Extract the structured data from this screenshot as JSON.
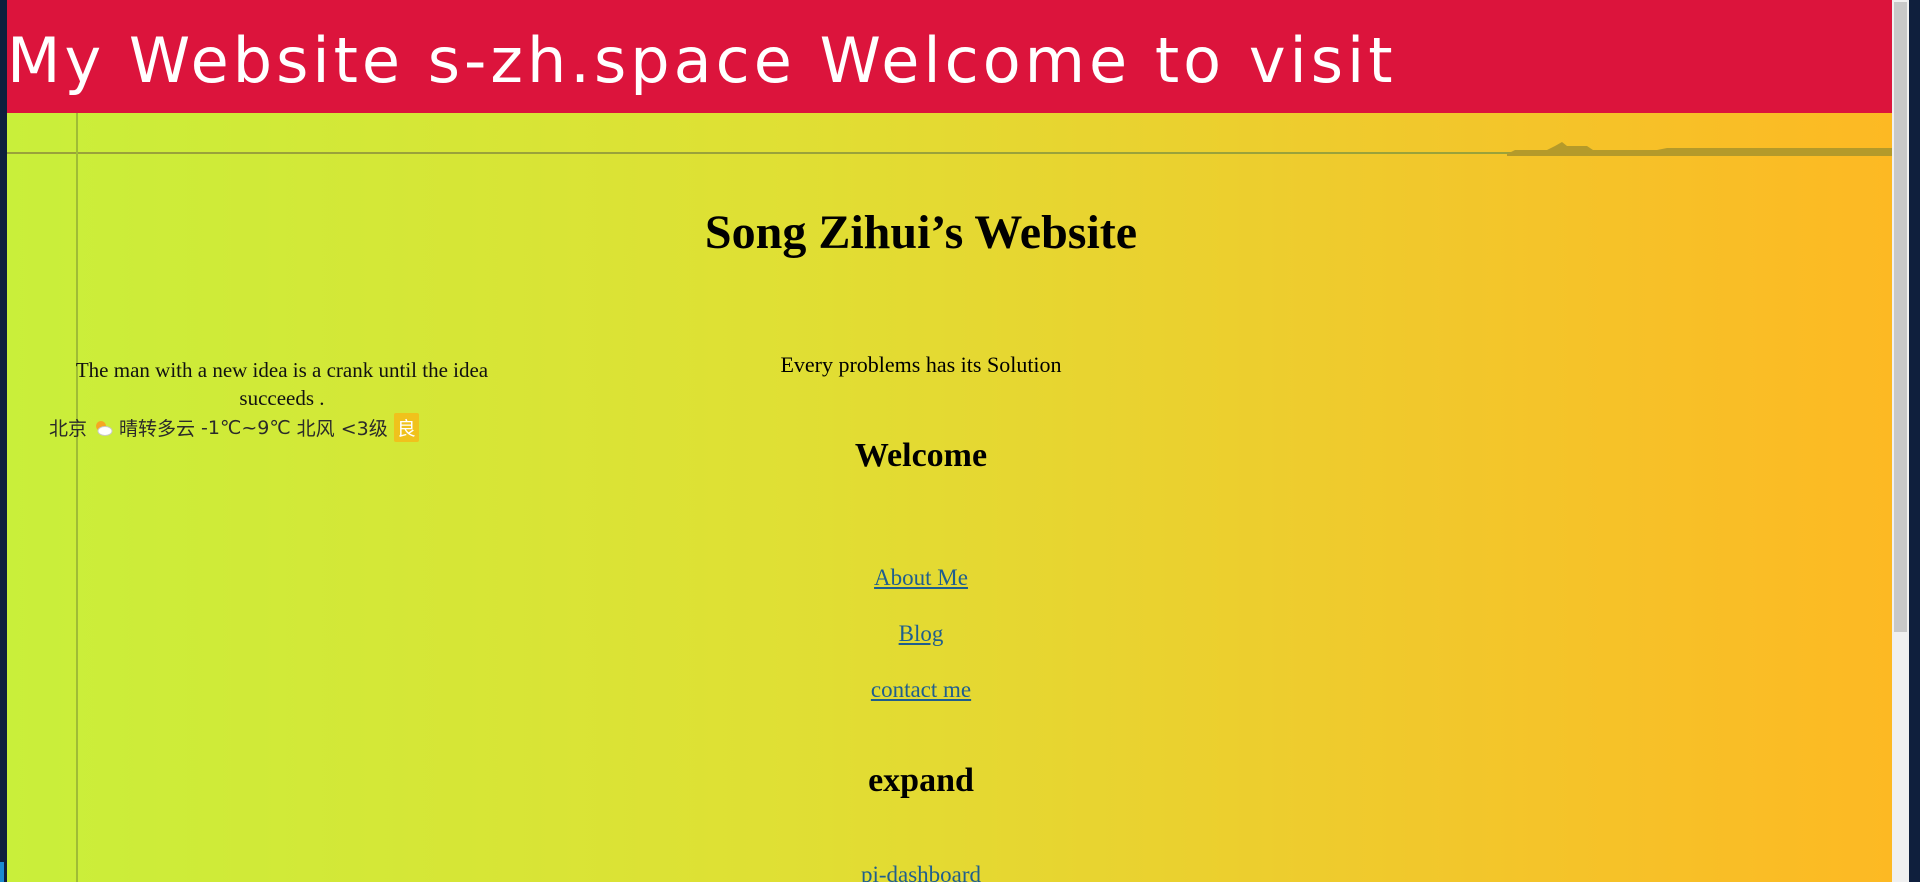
{
  "banner": {
    "text": "My Website s-zh.space Welcome to visit",
    "color": "#dc143c"
  },
  "page": {
    "title": "Song Zihui’s Website",
    "motto": "Every problems has its Solution",
    "welcome_heading": "Welcome",
    "expand_heading": "expand",
    "gradient_colors": [
      "#c9ef3a",
      "#fdb923"
    ]
  },
  "sidebar": {
    "quote": "The man with a new idea is a crank until the idea succeeds ."
  },
  "weather": {
    "city": "北京",
    "icon": "partly-cloudy-icon",
    "condition": "晴转多云",
    "temperature": "-1℃~9℃",
    "wind": "北风 <3级",
    "aqi": "良",
    "aqi_color": "#f0c21c"
  },
  "nav": {
    "links": [
      {
        "label": "About Me"
      },
      {
        "label": "Blog"
      },
      {
        "label": "contact me"
      }
    ],
    "expand_links": [
      {
        "label": "pi-dashboard"
      }
    ],
    "link_color": "#1f5e8e"
  }
}
